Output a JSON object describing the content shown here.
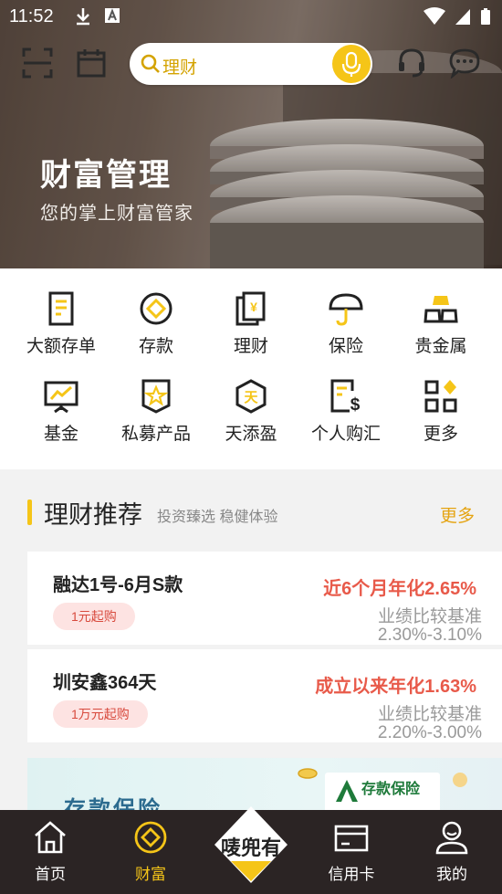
{
  "status_bar": {
    "time": "11:52"
  },
  "search": {
    "placeholder": "理财"
  },
  "hero": {
    "title": "财富管理",
    "subtitle": "您的掌上财富管家"
  },
  "grid": [
    {
      "label": "大额存单",
      "icon": "certificate-icon"
    },
    {
      "label": "存款",
      "icon": "deposit-icon"
    },
    {
      "label": "理财",
      "icon": "wealth-icon"
    },
    {
      "label": "保险",
      "icon": "umbrella-icon"
    },
    {
      "label": "贵金属",
      "icon": "gold-bars-icon"
    },
    {
      "label": "基金",
      "icon": "fund-chart-icon"
    },
    {
      "label": "私募产品",
      "icon": "private-fund-icon"
    },
    {
      "label": "天添盈",
      "icon": "tiantianying-icon"
    },
    {
      "label": "个人购汇",
      "icon": "forex-icon"
    },
    {
      "label": "更多",
      "icon": "more-grid-icon"
    }
  ],
  "recommend": {
    "title": "理财推荐",
    "subtitle": "投资臻选 稳健体验",
    "more": "更多",
    "products": [
      {
        "name": "融达1号-6月S款",
        "badge": "1元起购",
        "rate": "近6个月年化2.65%",
        "bench_label": "业绩比较基准",
        "bench_value": "2.30%-3.10%"
      },
      {
        "name": "圳安鑫364天",
        "badge": "1万元起购",
        "rate": "成立以来年化1.63%",
        "bench_label": "业绩比较基准",
        "bench_value": "2.20%-3.00%"
      }
    ]
  },
  "banner": {
    "title": "存款保险",
    "logo_text": "存款保险"
  },
  "bottom_nav": [
    {
      "label": "首页",
      "active": false
    },
    {
      "label": "财富",
      "active": true
    },
    {
      "label": "唛兜有",
      "center": true
    },
    {
      "label": "信用卡",
      "active": false
    },
    {
      "label": "我的",
      "active": false
    }
  ],
  "colors": {
    "accent": "#f5c518",
    "rate_red": "#e85a4a",
    "more_orange": "#e5a412",
    "nav_bg": "#2b2424"
  }
}
